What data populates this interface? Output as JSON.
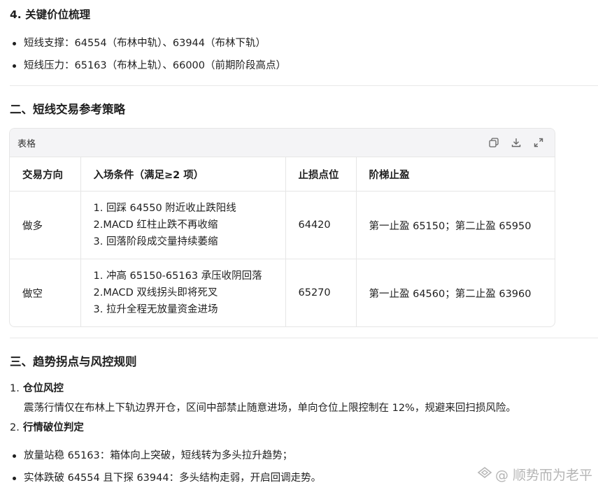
{
  "section4": {
    "title": "4. 关键价位梳理",
    "items": [
      "短线支撑：64554（布林中轨）、63944（布林下轨）",
      "短线压力：65163（布林上轨）、66000（前期阶段高点）"
    ]
  },
  "section2": {
    "title": "二、短线交易参考策略",
    "table": {
      "caption": "表格",
      "headers": [
        "交易方向",
        "入场条件（满足≥2 项）",
        "止损点位",
        "阶梯止盈"
      ],
      "rows": [
        {
          "direction": "做多",
          "conditions": [
            "1. 回踩 64550 附近收止跌阳线",
            "2.MACD 红柱止跌不再收缩",
            "3. 回落阶段成交量持续萎缩"
          ],
          "stop": "64420",
          "target": "第一止盈 65150；第二止盈 65950"
        },
        {
          "direction": "做空",
          "conditions": [
            "1. 冲高 65150-65163 承压收阴回落",
            "2.MACD 双线拐头即将死叉",
            "3. 拉升全程无放量资金进场"
          ],
          "stop": "65270",
          "target": "第一止盈 64560；第二止盈 63960"
        }
      ]
    }
  },
  "section3": {
    "title": "三、趋势拐点与风控规则",
    "items": [
      {
        "num": "1.",
        "title": "仓位风控",
        "body": "震荡行情仅在布林上下轨边界开仓，区间中部禁止随意进场，单向仓位上限控制在 12%，规避来回扫损风险。"
      },
      {
        "num": "2.",
        "title": "行情破位判定",
        "body": ""
      }
    ],
    "bullets": [
      "放量站稳 65163：箱体向上突破，短线转为多头拉升趋势；",
      "实体跌破 64554 且下探 63944：多头结构走弱，开启回调走势。"
    ]
  },
  "watermark": "@ 顺势而为老平"
}
